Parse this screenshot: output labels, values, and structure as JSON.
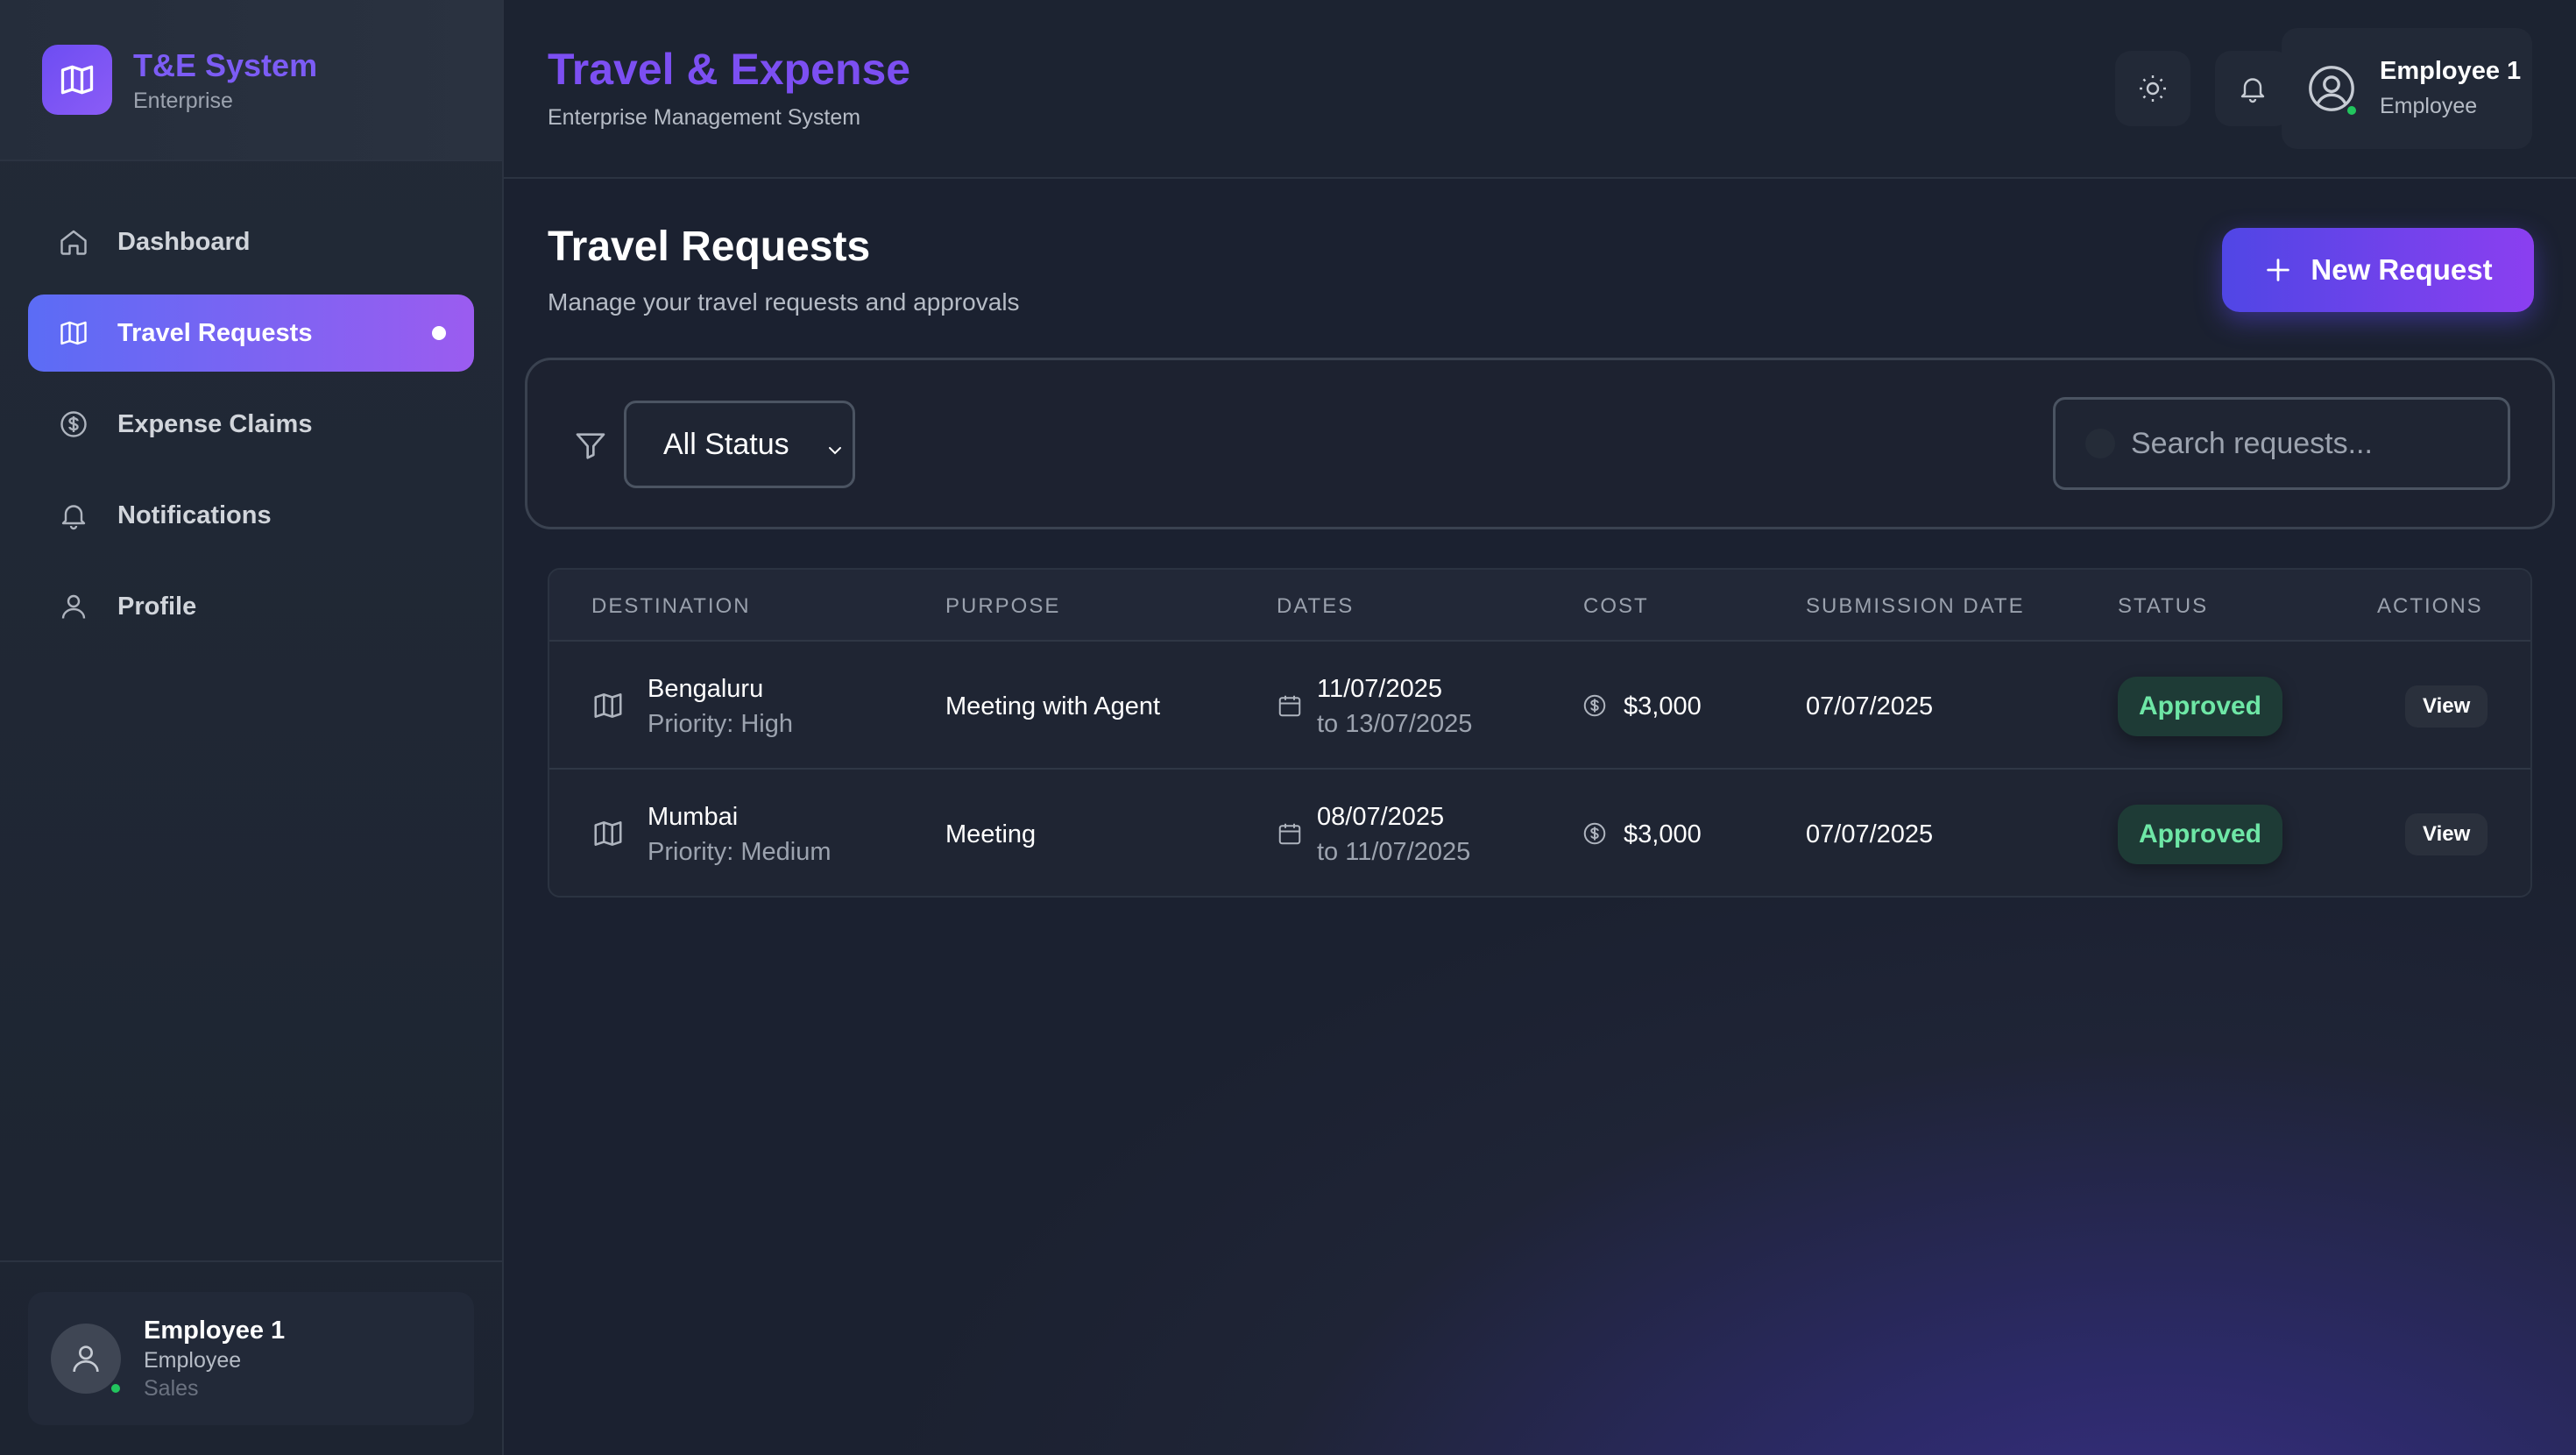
{
  "brand": {
    "title": "T&E System",
    "subtitle": "Enterprise"
  },
  "sidebar": {
    "items": [
      {
        "label": "Dashboard",
        "icon": "home-icon",
        "active": false
      },
      {
        "label": "Travel Requests",
        "icon": "map-icon",
        "active": true
      },
      {
        "label": "Expense Claims",
        "icon": "dollar-circle-icon",
        "active": false
      },
      {
        "label": "Notifications",
        "icon": "bell-icon",
        "active": false
      },
      {
        "label": "Profile",
        "icon": "user-icon",
        "active": false
      }
    ],
    "user": {
      "name": "Employee 1",
      "role": "Employee",
      "department": "Sales"
    }
  },
  "header": {
    "title": "Travel & Expense",
    "subtitle": "Enterprise Management System",
    "theme_icon": "sun-icon",
    "notification_icon": "bell-icon",
    "user": {
      "name": "Employee 1",
      "role": "Employee"
    }
  },
  "page": {
    "title": "Travel Requests",
    "subtitle": "Manage your travel requests and approvals",
    "new_button_label": "New Request"
  },
  "filters": {
    "status_selected": "All Status",
    "search_placeholder": "Search requests..."
  },
  "table": {
    "columns": [
      "DESTINATION",
      "PURPOSE",
      "DATES",
      "COST",
      "SUBMISSION DATE",
      "STATUS",
      "ACTIONS"
    ],
    "rows": [
      {
        "destination": "Bengaluru",
        "priority": "Priority: High",
        "purpose": "Meeting with Agent",
        "date_from": "11/07/2025",
        "date_to": "to 13/07/2025",
        "cost": "$3,000",
        "submission_date": "07/07/2025",
        "status": "Approved",
        "action": "View"
      },
      {
        "destination": "Mumbai",
        "priority": "Priority: Medium",
        "purpose": "Meeting",
        "date_from": "08/07/2025",
        "date_to": "to 11/07/2025",
        "cost": "$3,000",
        "submission_date": "07/07/2025",
        "status": "Approved",
        "action": "View"
      }
    ]
  },
  "colors": {
    "accent": "#7c4ff2",
    "active_gradient_start": "#5b6cf5",
    "active_gradient_end": "#9b5cf0",
    "approved_text": "#6ee7a6",
    "online": "#22c55e"
  }
}
